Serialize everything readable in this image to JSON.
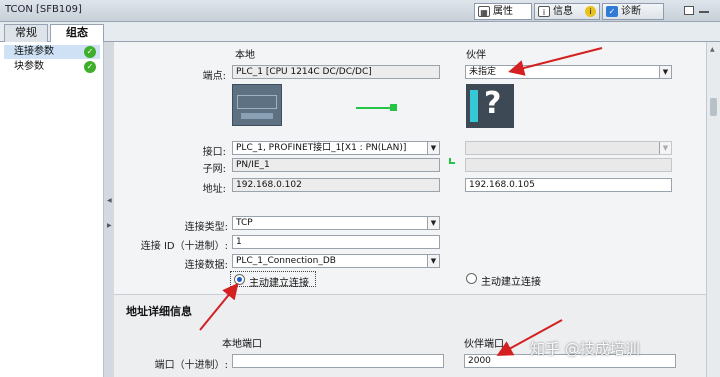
{
  "window": {
    "title": "TCON [SFB109]"
  },
  "panel_tabs": [
    {
      "label": "属性",
      "icon": "properties-icon"
    },
    {
      "label": "信息",
      "icon": "info-icon"
    },
    {
      "label": "诊断",
      "icon": "diagnostics-icon"
    }
  ],
  "sub_tabs": [
    {
      "label": "常规"
    },
    {
      "label": "组态"
    }
  ],
  "nav": [
    {
      "label": "连接参数",
      "status": "ok"
    },
    {
      "label": "块参数",
      "status": "ok"
    }
  ],
  "columns": {
    "local": "本地",
    "partner": "伙伴"
  },
  "endpoint": {
    "label": "端点:",
    "local": "PLC_1 [CPU 1214C DC/DC/DC]",
    "partner": "未指定"
  },
  "interface": {
    "label": "接口:",
    "local": "PLC_1, PROFINET接口_1[X1 : PN(LAN)]",
    "partner": ""
  },
  "subnet": {
    "label": "子网:",
    "local": "PN/IE_1",
    "partner": ""
  },
  "address": {
    "label": "地址:",
    "local": "192.168.0.102",
    "partner": "192.168.0.105"
  },
  "conn_type": {
    "label": "连接类型:",
    "value": "TCP"
  },
  "conn_id": {
    "label": "连接 ID（十进制）:",
    "value": "1"
  },
  "conn_data": {
    "label": "连接数据:",
    "value": "PLC_1_Connection_DB"
  },
  "active_conn": {
    "local_label": "主动建立连接",
    "local_selected": true,
    "partner_label": "主动建立连接",
    "partner_selected": false
  },
  "addr_details": {
    "title": "地址详细信息",
    "local_port_header": "本地端口",
    "partner_port_header": "伙伴端口",
    "port_label": "端口（十进制）:",
    "local_port": "",
    "partner_port": "2000"
  },
  "watermark": "知乎 @技成培训",
  "colors": {
    "arrow": "#d42020",
    "accent": "#1b58c9",
    "ok": "#3fae2a"
  }
}
